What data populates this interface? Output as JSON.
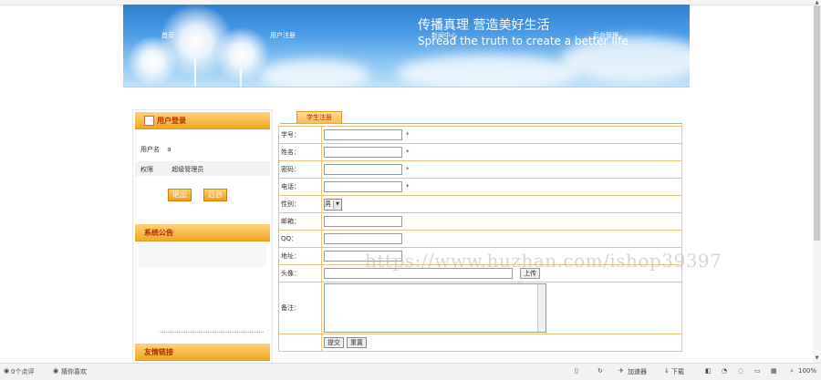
{
  "banner": {
    "nav": [
      "首页",
      "用户注册",
      "新闻中心",
      "后台管理"
    ],
    "slogan_cn": "传播真理 营造美好生活",
    "slogan_en": "Spread the truth to create a better life"
  },
  "sidebar": {
    "login_title": "用户登录",
    "username_label": "用户名",
    "username_value": "a",
    "role_label": "权限",
    "role_value": "超级管理员",
    "logout_button": "退出",
    "admin_button": "后台",
    "notice_title": "系统公告",
    "links_title": "友情链接"
  },
  "main": {
    "tab": "学生注册",
    "fields": [
      {
        "label": "学号：",
        "required": "*"
      },
      {
        "label": "姓名：",
        "required": "*"
      },
      {
        "label": "密码：",
        "required": "*"
      },
      {
        "label": "电话：",
        "required": "*"
      },
      {
        "label": "性别：",
        "value": "男"
      },
      {
        "label": "邮箱："
      },
      {
        "label": "QQ："
      },
      {
        "label": "地址："
      },
      {
        "label": "头像：",
        "button": "上传"
      },
      {
        "label": "备注："
      }
    ],
    "submit": "提交",
    "reset": "重置"
  },
  "watermark": "https://www.huzhan.com/ishop39397",
  "statusbar": {
    "comments": "0个点评",
    "favorite": "猜你喜欢",
    "speed": "加速器",
    "download": "下载",
    "zoom": "100%"
  },
  "colors": {
    "accent": "#f3a624",
    "title_red": "#b22c00",
    "sky": "#4a9be6"
  }
}
